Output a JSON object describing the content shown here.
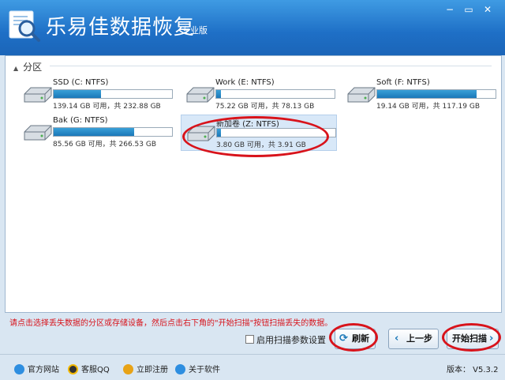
{
  "app": {
    "title": "乐易佳数据恢复",
    "edition": "专业版"
  },
  "window_controls": {
    "minimize": "−",
    "restore": "▭",
    "close": "✕"
  },
  "section_label": "分区",
  "drives": [
    {
      "name": "SSD (C: NTFS)",
      "size": "139.14 GB 可用，共 232.88 GB",
      "used_fraction": 0.4,
      "selected": false
    },
    {
      "name": "Work (E: NTFS)",
      "size": "75.22 GB 可用，共 78.13 GB",
      "used_fraction": 0.04,
      "selected": false
    },
    {
      "name": "Soft (F: NTFS)",
      "size": "19.14 GB 可用，共 117.19 GB",
      "used_fraction": 0.84,
      "selected": false
    },
    {
      "name": "Bak (G: NTFS)",
      "size": "85.56 GB 可用，共 266.53 GB",
      "used_fraction": 0.68,
      "selected": false
    },
    {
      "name": "新加卷 (Z: NTFS)",
      "size": "3.80 GB 可用，共 3.91 GB",
      "used_fraction": 0.03,
      "selected": true
    }
  ],
  "hint": "请点击选择丢失数据的分区或存储设备，然后点击右下角的\"开始扫描\"按钮扫描丢失的数据。",
  "options": {
    "scan_settings_label": "启用扫描参数设置"
  },
  "buttons": {
    "refresh": "刷新",
    "back": "上一步",
    "start_scan": "开始扫描"
  },
  "footer": {
    "website": "官方网站",
    "support": "客服QQ",
    "register": "立即注册",
    "about": "关于软件",
    "version": "版本： V5.3.2"
  },
  "colors": {
    "titlebar": "#1e6fc6",
    "highlight": "#d8131b",
    "bar_fill": "#1a78b8"
  }
}
